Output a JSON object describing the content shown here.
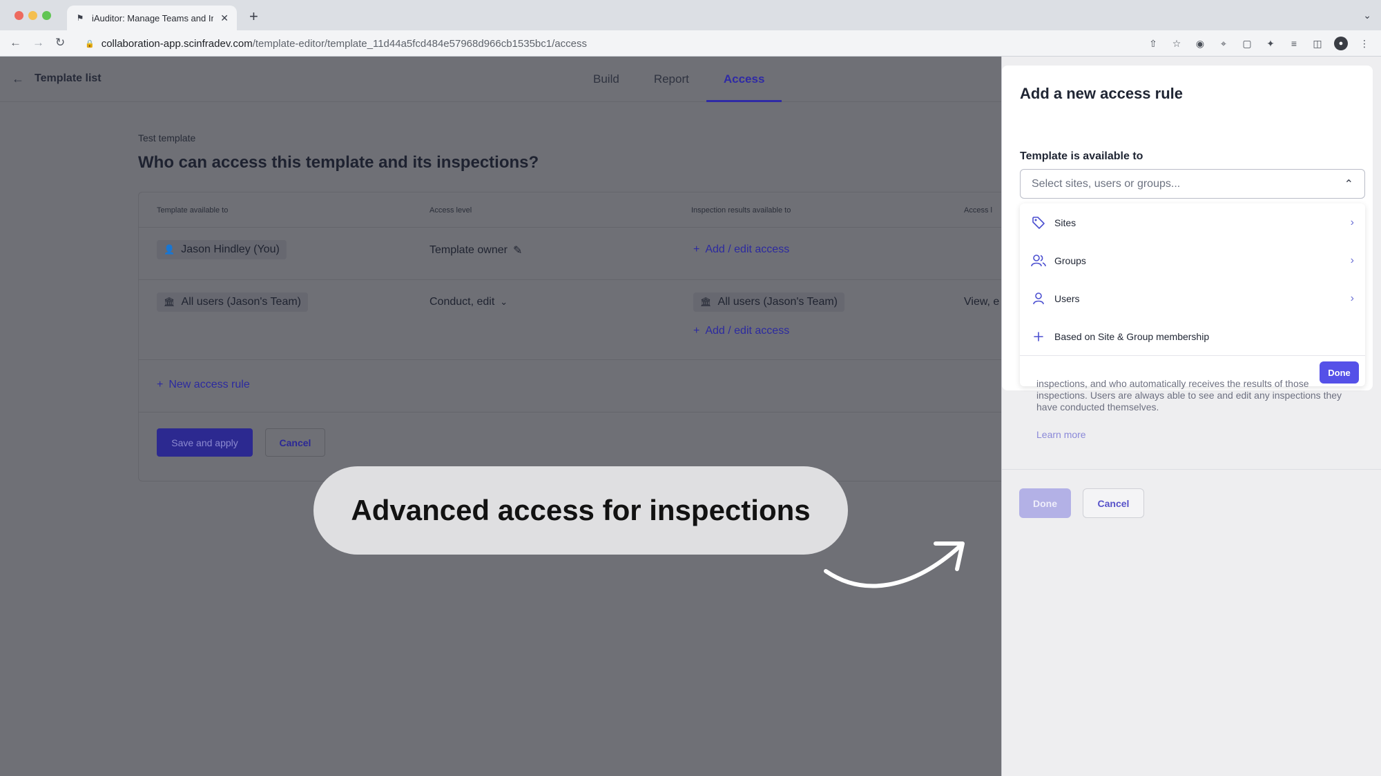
{
  "browser": {
    "tab_title": "iAuditor: Manage Teams and In",
    "url_host": "collaboration-app.scinfradev.com",
    "url_path": "/template-editor/template_11d44a5fcd484e57968d966cb1535bc1/access"
  },
  "header": {
    "back_label": "Template list",
    "tabs": [
      "Build",
      "Report",
      "Access"
    ],
    "active_tab": "Access"
  },
  "page": {
    "subtitle": "Test template",
    "title": "Who can access this template and its inspections?"
  },
  "table": {
    "columns": [
      "Template available to",
      "Access level",
      "Inspection results available to",
      "Access l"
    ],
    "rows": [
      {
        "available_to": "Jason Hindley (You)",
        "access_level": "Template owner",
        "results_link": "Add / edit access"
      },
      {
        "available_to": "All users (Jason's Team)",
        "access_level": "Conduct, edit",
        "results_to": "All users (Jason's Team)",
        "results_access": "View, e",
        "results_link": "Add / edit access"
      }
    ],
    "new_rule": "New access rule",
    "save_label": "Save and apply",
    "cancel_label": "Cancel"
  },
  "callout": {
    "text": "Advanced access for inspections"
  },
  "panel": {
    "title": "Add a new access rule",
    "field_label": "Template is available to",
    "select_placeholder": "Select sites, users or groups...",
    "options": [
      {
        "label": "Sites",
        "icon": "tag-icon"
      },
      {
        "label": "Groups",
        "icon": "users-icon"
      },
      {
        "label": "Users",
        "icon": "user-icon"
      },
      {
        "label": "Based on Site & Group membership",
        "icon": "plus-icon"
      }
    ],
    "dropdown_done": "Done",
    "description": "inspections, and who automatically receives the results of those inspections. Users are always able to see and edit any inspections they have conducted themselves.",
    "learn_more": "Learn more",
    "done_label": "Done",
    "cancel_label": "Cancel"
  },
  "colors": {
    "accent": "#5551e8",
    "dim_overlay": "#6f7076"
  }
}
